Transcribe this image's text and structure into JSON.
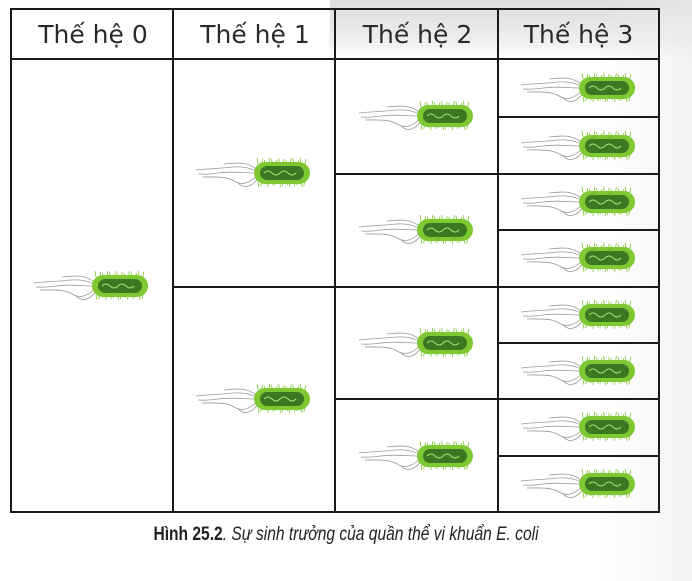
{
  "figure": {
    "headers": [
      "Thế hệ 0",
      "Thế hệ 1",
      "Thế hệ 2",
      "Thế hệ 3"
    ],
    "generations": [
      {
        "label": "Thế hệ 0",
        "cell_count": 1
      },
      {
        "label": "Thế hệ 1",
        "cell_count": 2
      },
      {
        "label": "Thế hệ 2",
        "cell_count": 4
      },
      {
        "label": "Thế hệ 3",
        "cell_count": 8
      }
    ],
    "organism_icon": "e-coli-bacterium-icon",
    "colors": {
      "body": "#7ec832",
      "body_dark": "#2f6a1f",
      "flagella": "#9a9a9a",
      "grid": "#1a1a1a"
    }
  },
  "caption": {
    "number": "Hình 25.2",
    "text": ". Sự sinh trưởng của quần thể vi khuẩn E. coli"
  }
}
